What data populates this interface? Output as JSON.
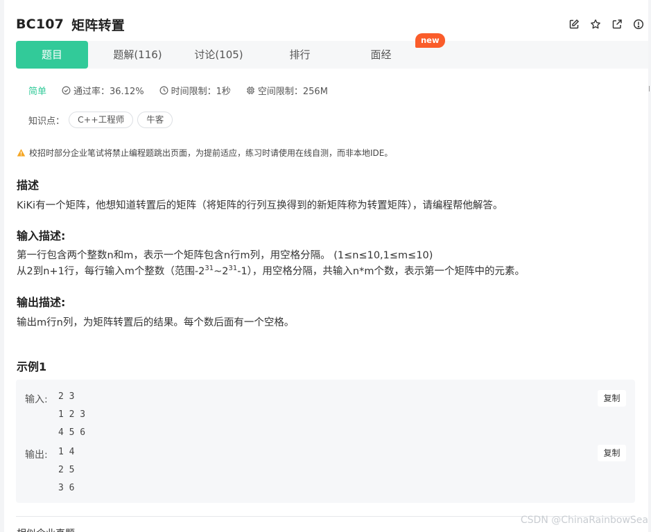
{
  "problem": {
    "code": "BC107",
    "name": "矩阵转置"
  },
  "tabs": [
    {
      "label": "题目",
      "active": true
    },
    {
      "label": "题解(116)",
      "active": false
    },
    {
      "label": "讨论(105)",
      "active": false
    },
    {
      "label": "排行",
      "active": false
    },
    {
      "label": "面经",
      "active": false
    }
  ],
  "badge": "new",
  "meta": {
    "level": "简单",
    "pass_rate": "通过率：36.12%",
    "time_limit": "时间限制：1秒",
    "space_limit": "空间限制：256M"
  },
  "knowledge": {
    "label": "知识点：",
    "tags": [
      "C++工程师",
      "牛客"
    ]
  },
  "notice": "校招时部分企业笔试将禁止编程题跳出页面，为提前适应，练习时请使用在线自测，而非本地IDE。",
  "description": {
    "heading": "描述",
    "text": "KiKi有一个矩阵，他想知道转置后的矩阵（将矩阵的行列互换得到的新矩阵称为转置矩阵），请编程帮他解答。"
  },
  "input_desc": {
    "heading": "输入描述:",
    "line1": "第一行包含两个整数n和m，表示一个矩阵包含n行m列，用空格分隔。 (1≤n≤10,1≤m≤10)",
    "line2_a": "从2到n+1行，每行输入m个整数（范围-2",
    "line2_sup1": "31",
    "line2_b": "~2",
    "line2_sup2": "31",
    "line2_c": "-1），用空格分隔，共输入n*m个数，表示第一个矩阵中的元素。"
  },
  "output_desc": {
    "heading": "输出描述:",
    "text": "输出m行n列，为矩阵转置后的结果。每个数后面有一个空格。"
  },
  "example": {
    "heading": "示例1",
    "input_label": "输入:",
    "input_lines": [
      "2 3",
      "1 2 3",
      "4 5 6"
    ],
    "output_label": "输出:",
    "output_lines": [
      "1 4",
      "2 5",
      "3 6"
    ],
    "copy_label": "复制"
  },
  "cut_text": "相似企业真题",
  "watermark": "CSDN @ChinaRainbowSea"
}
